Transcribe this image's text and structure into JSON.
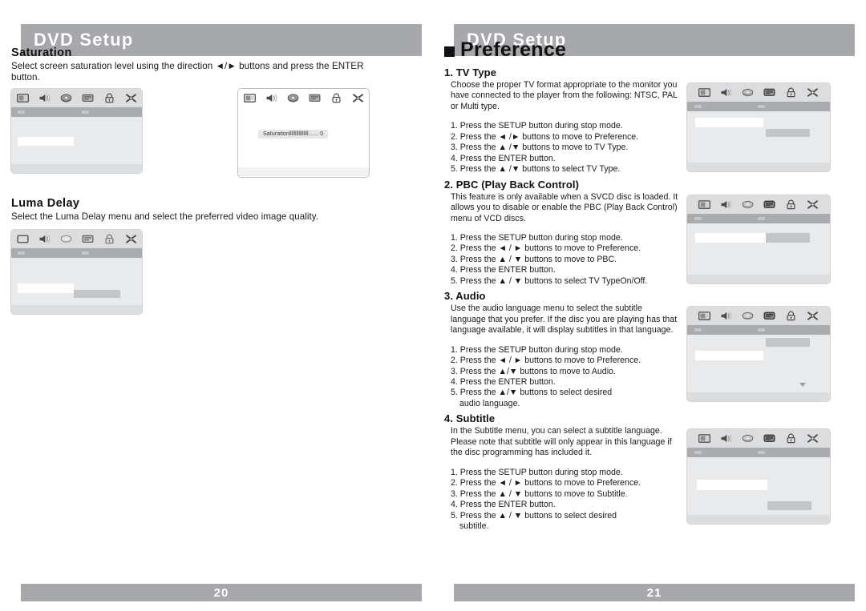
{
  "document": {
    "type": "dvd-player-user-manual-spread",
    "colors": {
      "header_bar": "#a6a8ab",
      "footer_bar": "#a6a8ab",
      "header_text": "#ffffff",
      "body_text": "#1a1a1a",
      "osd_background": "#e9eaec",
      "osd_iconbar": "#dcdddf",
      "osd_tabbar": "#a9abaf",
      "osd_highlight": "#ffffff",
      "osd_selection": "#c3c5c8"
    }
  },
  "left_page": {
    "header_title": "DVD Setup",
    "page_number": "20",
    "sections": [
      {
        "title": "Saturation",
        "description": "Select screen saturation level using the direction ◄/► buttons and press the ENTER button.",
        "screens": [
          {
            "name": "saturation-menu-screen",
            "style": "flat",
            "icons": [
              "tv-icon",
              "speaker-icon",
              "disc-icon",
              "display-icon",
              "lock-icon",
              "tools-icon"
            ]
          },
          {
            "name": "saturation-slider-screen",
            "style": "framed",
            "icons": [
              "tv-icon",
              "speaker-icon",
              "disc-icon",
              "display-icon",
              "lock-icon",
              "tools-icon"
            ],
            "slider_label": "Saturation",
            "slider_bars": "‖‖‖‖‖‖‖‖",
            "slider_dots": "......",
            "slider_value": "0"
          }
        ]
      },
      {
        "title": "Luma Delay",
        "description": "Select the Luma Delay menu and select the preferred video image quality.",
        "screens": [
          {
            "name": "luma-delay-menu-screen",
            "style": "flat",
            "icons": [
              "tv-icon",
              "speaker-icon",
              "disc-icon",
              "display-icon",
              "lock-icon",
              "tools-icon"
            ]
          }
        ]
      }
    ]
  },
  "right_page": {
    "header_title": "DVD Setup",
    "page_number": "21",
    "section_title": "Preference",
    "items": [
      {
        "heading": "1. TV Type",
        "description": "Choose the proper TV format appropriate to the monitor you have connected to the player from the following: NTSC, PAL or Multi type.",
        "steps": [
          "1. Press the SETUP button during stop mode.",
          "2. Press the ◄ /►  buttons to move to Preference.",
          "3. Press the ▲ /▼  buttons to move to TV Type.",
          "4. Press the ENTER button.",
          "5. Press the ▲ /▼  buttons to select TV Type."
        ],
        "screen": {
          "name": "tv-type-osd-screen",
          "icons": [
            "tv-icon",
            "speaker-icon",
            "disc-icon",
            "display-icon",
            "lock-icon",
            "tools-icon"
          ]
        }
      },
      {
        "heading": "2. PBC (Play Back Control)",
        "description": "This feature is only available when a SVCD disc is loaded. It allows you to disable or enable the PBC (Play Back Control) menu of VCD discs.",
        "steps": [
          "1. Press the SETUP button during stop mode.",
          "2. Press the ◄ / ► buttons to move to Preference.",
          "3. Press the ▲ / ▼ buttons to move to PBC.",
          "4. Press the ENTER button.",
          "5. Press the ▲ / ▼ buttons to select TV TypeOn/Off."
        ],
        "screen": {
          "name": "pbc-osd-screen",
          "icons": [
            "tv-icon",
            "speaker-icon",
            "disc-icon",
            "display-icon",
            "lock-icon",
            "tools-icon"
          ]
        }
      },
      {
        "heading": "3. Audio",
        "description": "Use the audio language menu to select the subtitle language that you prefer. If the disc you are playing has that language available, it will display subtitles in that language.",
        "steps": [
          "1. Press the SETUP button during stop mode.",
          "2. Press the ◄ / ►  buttons to move to Preference.",
          "3. Press the ▲/▼  buttons to move to Audio.",
          "4. Press the ENTER button.",
          "5. Press the ▲/▼  buttons to select desired",
          "audio language."
        ],
        "screen": {
          "name": "audio-osd-screen",
          "icons": [
            "tv-icon",
            "speaker-icon",
            "disc-icon",
            "display-icon",
            "lock-icon",
            "tools-icon"
          ]
        }
      },
      {
        "heading": "4. Subtitle",
        "description": "In the Subtitle menu, you can select a subtitle language. Please note that subtitle will only appear in this language if the disc programming has included it.",
        "steps": [
          "1. Press the SETUP button during stop mode.",
          "2. Press the ◄ / ►  buttons to move to Preference.",
          "3. Press the ▲ / ▼  buttons to move to Subtitle.",
          "4. Press the ENTER button.",
          "5. Press the ▲ / ▼ buttons to select desired",
          "subtitle."
        ],
        "screen": {
          "name": "subtitle-osd-screen",
          "icons": [
            "tv-icon",
            "speaker-icon",
            "disc-icon",
            "display-icon",
            "lock-icon",
            "tools-icon"
          ]
        }
      }
    ]
  }
}
